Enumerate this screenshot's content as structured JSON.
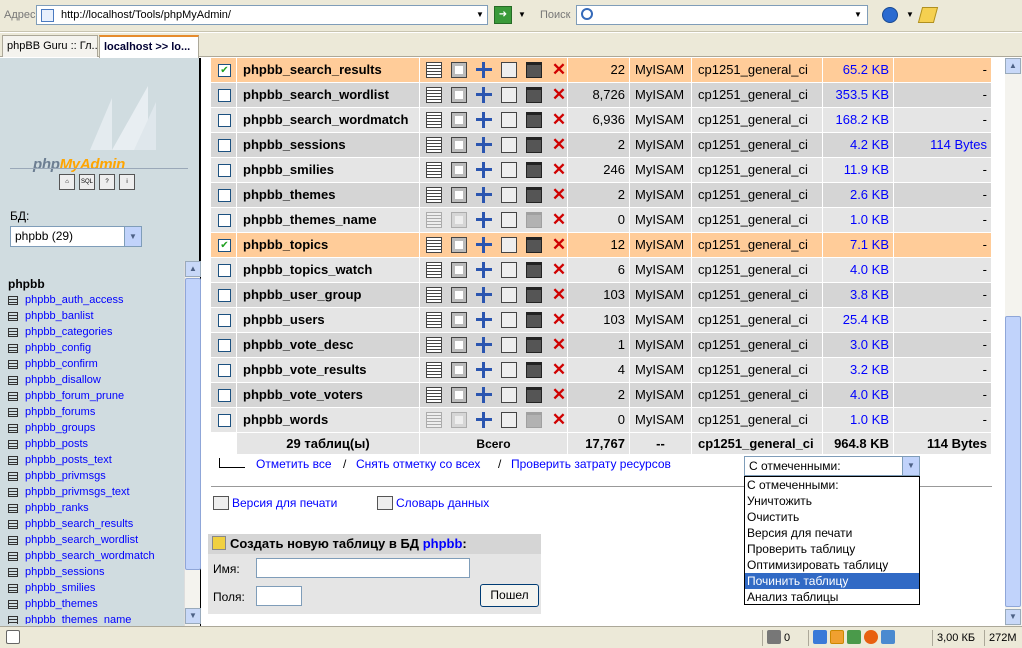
{
  "browser": {
    "address_label": "Адрес",
    "url": "http://localhost/Tools/phpMyAdmin/",
    "search_label": "Поиск",
    "tabs": [
      {
        "label": "phpBB Guru :: Гл..."
      },
      {
        "label": "localhost >> lo..."
      }
    ]
  },
  "sidebar": {
    "logo_text_a": "php",
    "logo_text_b": "MyAdmin",
    "db_label": "БД:",
    "db_select": "phpbb (29)",
    "db_name": "phpbb",
    "tables": [
      "phpbb_auth_access",
      "phpbb_banlist",
      "phpbb_categories",
      "phpbb_config",
      "phpbb_confirm",
      "phpbb_disallow",
      "phpbb_forum_prune",
      "phpbb_forums",
      "phpbb_groups",
      "phpbb_posts",
      "phpbb_posts_text",
      "phpbb_privmsgs",
      "phpbb_privmsgs_text",
      "phpbb_ranks",
      "phpbb_search_results",
      "phpbb_search_wordlist",
      "phpbb_search_wordmatch",
      "phpbb_sessions",
      "phpbb_smilies",
      "phpbb_themes",
      "phpbb_themes_name"
    ]
  },
  "table_rows": [
    {
      "name": "phpbb_search_results",
      "records": "22",
      "type": "MyISAM",
      "collation": "cp1251_general_ci",
      "size": "65.2 KB",
      "overhead": "-",
      "checked": true,
      "dim": false
    },
    {
      "name": "phpbb_search_wordlist",
      "records": "8,726",
      "type": "MyISAM",
      "collation": "cp1251_general_ci",
      "size": "353.5 KB",
      "overhead": "-",
      "checked": false,
      "dim": false
    },
    {
      "name": "phpbb_search_wordmatch",
      "records": "6,936",
      "type": "MyISAM",
      "collation": "cp1251_general_ci",
      "size": "168.2 KB",
      "overhead": "-",
      "checked": false,
      "dim": false
    },
    {
      "name": "phpbb_sessions",
      "records": "2",
      "type": "MyISAM",
      "collation": "cp1251_general_ci",
      "size": "4.2 KB",
      "overhead": "114 Bytes",
      "checked": false,
      "dim": false
    },
    {
      "name": "phpbb_smilies",
      "records": "246",
      "type": "MyISAM",
      "collation": "cp1251_general_ci",
      "size": "11.9 KB",
      "overhead": "-",
      "checked": false,
      "dim": false
    },
    {
      "name": "phpbb_themes",
      "records": "2",
      "type": "MyISAM",
      "collation": "cp1251_general_ci",
      "size": "2.6 KB",
      "overhead": "-",
      "checked": false,
      "dim": false
    },
    {
      "name": "phpbb_themes_name",
      "records": "0",
      "type": "MyISAM",
      "collation": "cp1251_general_ci",
      "size": "1.0 KB",
      "overhead": "-",
      "checked": false,
      "dim": true
    },
    {
      "name": "phpbb_topics",
      "records": "12",
      "type": "MyISAM",
      "collation": "cp1251_general_ci",
      "size": "7.1 KB",
      "overhead": "-",
      "checked": true,
      "dim": false
    },
    {
      "name": "phpbb_topics_watch",
      "records": "6",
      "type": "MyISAM",
      "collation": "cp1251_general_ci",
      "size": "4.0 KB",
      "overhead": "-",
      "checked": false,
      "dim": false
    },
    {
      "name": "phpbb_user_group",
      "records": "103",
      "type": "MyISAM",
      "collation": "cp1251_general_ci",
      "size": "3.8 KB",
      "overhead": "-",
      "checked": false,
      "dim": false
    },
    {
      "name": "phpbb_users",
      "records": "103",
      "type": "MyISAM",
      "collation": "cp1251_general_ci",
      "size": "25.4 KB",
      "overhead": "-",
      "checked": false,
      "dim": false
    },
    {
      "name": "phpbb_vote_desc",
      "records": "1",
      "type": "MyISAM",
      "collation": "cp1251_general_ci",
      "size": "3.0 KB",
      "overhead": "-",
      "checked": false,
      "dim": false
    },
    {
      "name": "phpbb_vote_results",
      "records": "4",
      "type": "MyISAM",
      "collation": "cp1251_general_ci",
      "size": "3.2 KB",
      "overhead": "-",
      "checked": false,
      "dim": false
    },
    {
      "name": "phpbb_vote_voters",
      "records": "2",
      "type": "MyISAM",
      "collation": "cp1251_general_ci",
      "size": "4.0 KB",
      "overhead": "-",
      "checked": false,
      "dim": false
    },
    {
      "name": "phpbb_words",
      "records": "0",
      "type": "MyISAM",
      "collation": "cp1251_general_ci",
      "size": "1.0 KB",
      "overhead": "-",
      "checked": false,
      "dim": true
    }
  ],
  "totals": {
    "tables": "29 таблиц(ы)",
    "sum_label": "Всего",
    "records": "17,767",
    "type": "--",
    "collation": "cp1251_general_ci",
    "size": "964.8 KB",
    "overhead": "114 Bytes"
  },
  "check_links": {
    "check_all": "Отметить все",
    "sep": "/",
    "uncheck_all": "Снять отметку со всех",
    "check_overhead": "Проверить затрату ресурсов"
  },
  "with_selected": {
    "value": "С отмеченными:",
    "options": [
      {
        "label": "С отмеченными:",
        "highlighted": false
      },
      {
        "label": "Уничтожить",
        "highlighted": false
      },
      {
        "label": "Очистить",
        "highlighted": false
      },
      {
        "label": "Версия для печати",
        "highlighted": false
      },
      {
        "label": "Проверить таблицу",
        "highlighted": false
      },
      {
        "label": "Оптимизировать таблицу",
        "highlighted": false
      },
      {
        "label": "Починить таблицу",
        "highlighted": true
      },
      {
        "label": "Анализ таблицы",
        "highlighted": false
      }
    ]
  },
  "links": {
    "print_view": "Версия для печати",
    "data_dict": "Словарь данных"
  },
  "create_table": {
    "heading": "Создать новую таблицу в БД",
    "db": "phpbb",
    "colon": ":",
    "name_label": "Имя:",
    "fields_label": "Поля:",
    "go_label": "Пошел"
  },
  "statusbar": {
    "trash_count": "0",
    "size": "3,00 КБ",
    "mem": "272М"
  },
  "colors": {
    "selected_row": "#ffcc99",
    "odd_row": "#e5e5e5",
    "even_row": "#d5d5d5",
    "link": "#0000ff",
    "highlight": "#316ac5"
  }
}
